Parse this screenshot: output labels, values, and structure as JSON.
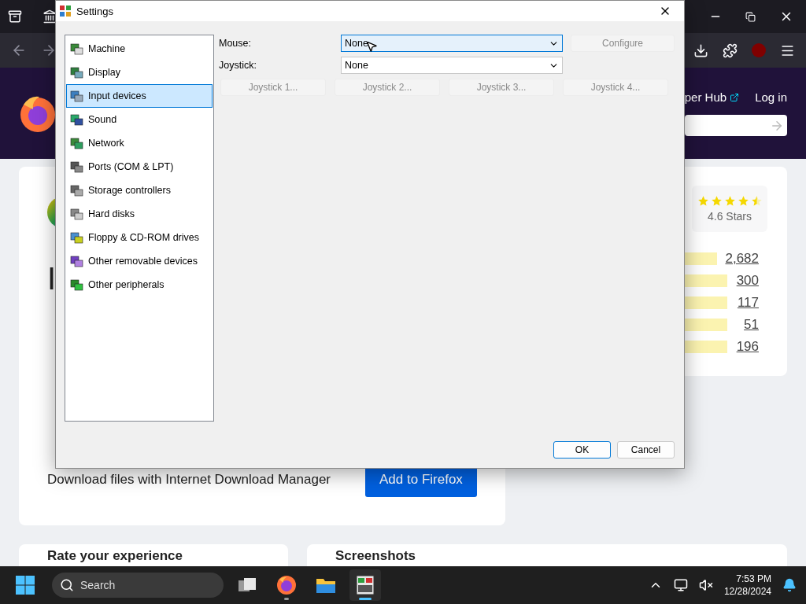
{
  "browser": {
    "header_links": [
      "per Hub",
      "Log in"
    ]
  },
  "listing": {
    "title_fragments": [
      "I"
    ],
    "description": "Download files with Internet Download Manager",
    "install_button": "Add to Firefox"
  },
  "ratings": {
    "stars": 4.5,
    "summary": "4.6 Stars",
    "counts": [
      "2,682",
      "300",
      "117",
      "51",
      "196"
    ]
  },
  "sections": [
    "Rate your experience",
    "Screenshots"
  ],
  "dialog": {
    "title": "Settings",
    "categories": [
      {
        "label": "Machine",
        "selected": false
      },
      {
        "label": "Display",
        "selected": false
      },
      {
        "label": "Input devices",
        "selected": true
      },
      {
        "label": "Sound",
        "selected": false
      },
      {
        "label": "Network",
        "selected": false
      },
      {
        "label": "Ports (COM & LPT)",
        "selected": false
      },
      {
        "label": "Storage controllers",
        "selected": false
      },
      {
        "label": "Hard disks",
        "selected": false
      },
      {
        "label": "Floppy & CD-ROM drives",
        "selected": false
      },
      {
        "label": "Other removable devices",
        "selected": false
      },
      {
        "label": "Other peripherals",
        "selected": false
      }
    ],
    "mouse": {
      "label": "Mouse:",
      "value": "None",
      "focused": true
    },
    "configure": {
      "label": "Configure",
      "disabled": true
    },
    "joystick": {
      "label": "Joystick:",
      "value": "None",
      "focused": false
    },
    "joystick_buttons": [
      {
        "label": "Joystick 1...",
        "disabled": true
      },
      {
        "label": "Joystick 2...",
        "disabled": true
      },
      {
        "label": "Joystick 3...",
        "disabled": true
      },
      {
        "label": "Joystick 4...",
        "disabled": true
      }
    ],
    "buttons": [
      {
        "label": "OK",
        "default": true
      },
      {
        "label": "Cancel",
        "default": false
      }
    ]
  },
  "taskbar": {
    "search_placeholder": "Search",
    "apps": [
      {
        "kind": "task-view",
        "running": false,
        "selected": false
      },
      {
        "kind": "firefox",
        "running": true,
        "selected": false
      },
      {
        "kind": "files",
        "running": false,
        "selected": false
      },
      {
        "kind": "virtual-machine",
        "running": true,
        "selected": true
      }
    ],
    "time": "7:53 PM",
    "date": "12/28/2024"
  }
}
